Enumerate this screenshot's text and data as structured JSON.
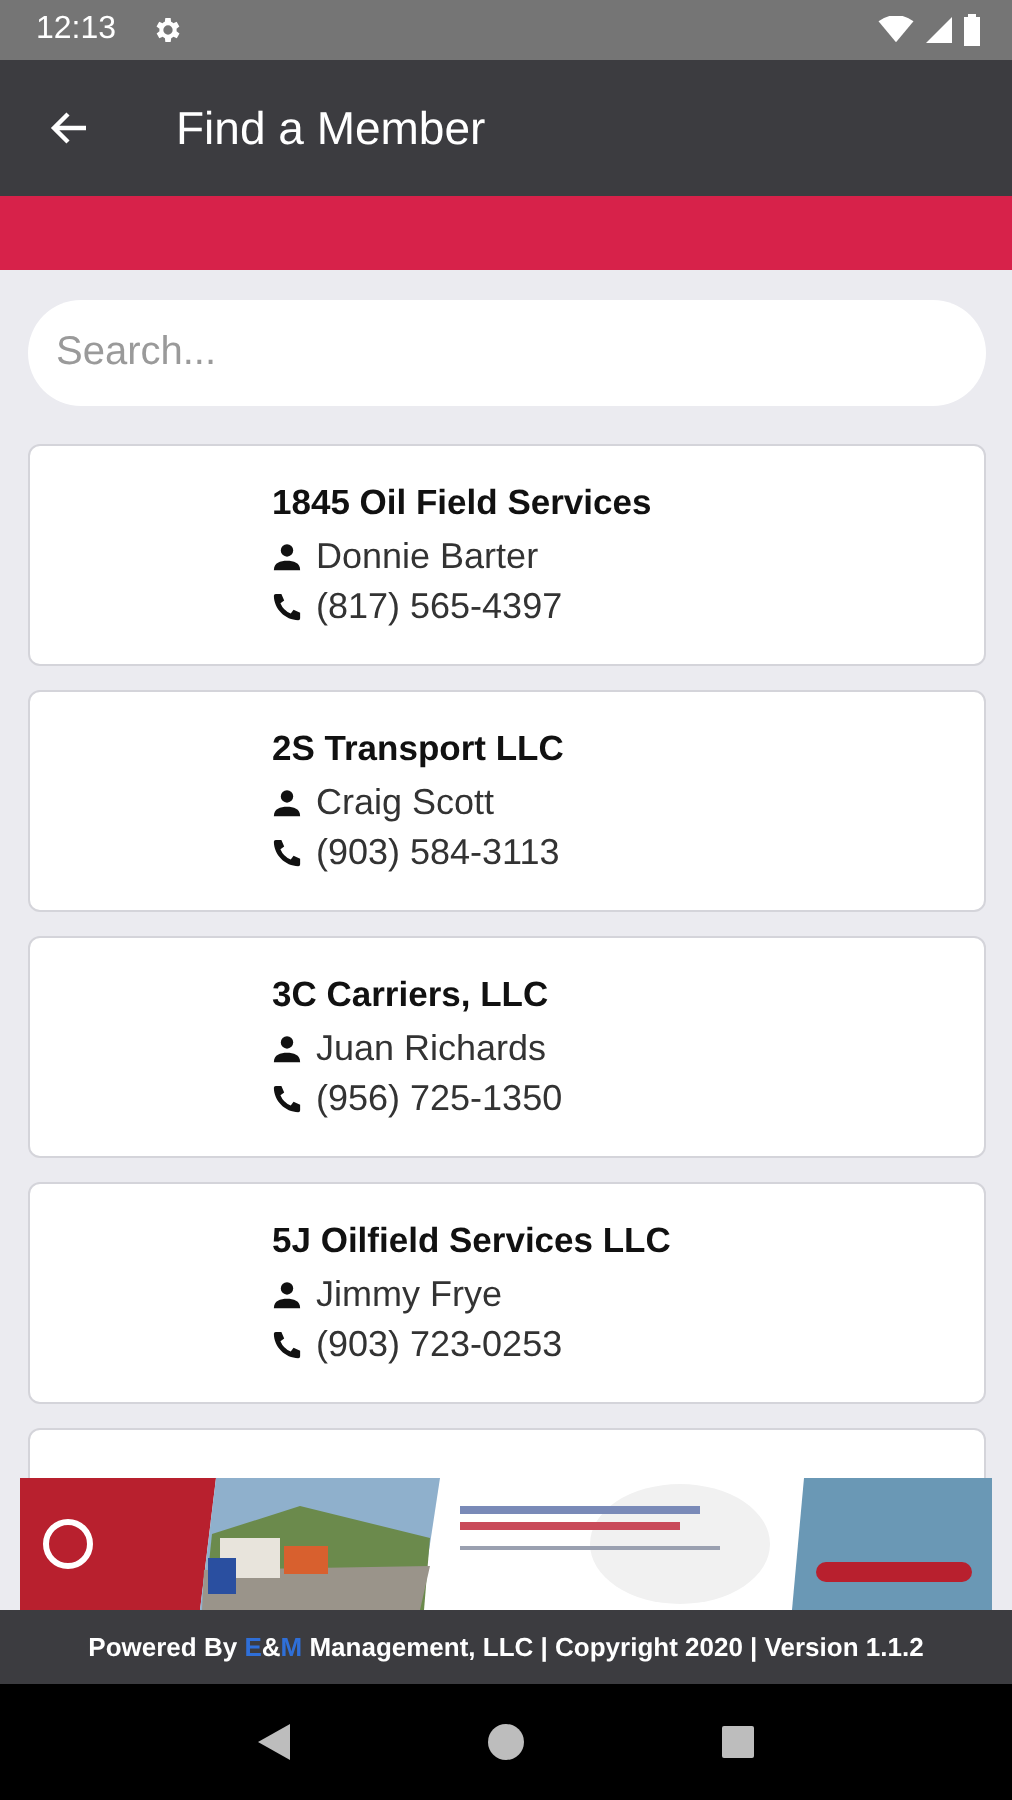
{
  "status_bar": {
    "time": "12:13"
  },
  "app_bar": {
    "title": "Find a Member"
  },
  "search": {
    "placeholder": "Search..."
  },
  "members": [
    {
      "company": "1845 Oil Field Services",
      "contact": "Donnie Barter",
      "phone": "(817) 565-4397"
    },
    {
      "company": "2S Transport LLC",
      "contact": "Craig Scott",
      "phone": "(903) 584-3113"
    },
    {
      "company": "3C Carriers, LLC",
      "contact": "Juan Richards",
      "phone": "(956) 725-1350"
    },
    {
      "company": "5J Oilfield Services LLC",
      "contact": "Jimmy Frye",
      "phone": "(903) 723-0253"
    }
  ],
  "footer": [
    {
      "text": "Powered By ",
      "accent": false
    },
    {
      "text": "E",
      "accent": true
    },
    {
      "text": "&",
      "accent": false
    },
    {
      "text": "M",
      "accent": true
    },
    {
      "text": " Management, LLC | Copyright 2020 | Version 1.1.2",
      "accent": false
    }
  ]
}
